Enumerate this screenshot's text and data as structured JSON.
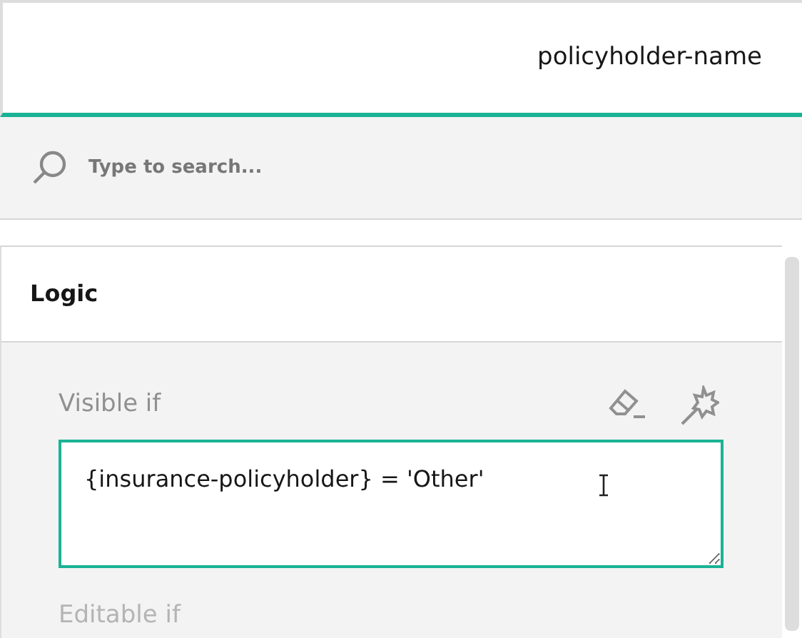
{
  "header": {
    "title": "policyholder-name"
  },
  "search": {
    "placeholder": "Type to search..."
  },
  "section": {
    "title": "Logic",
    "expanded": true
  },
  "properties": [
    {
      "label": "Visible if",
      "value": "{insurance-policyholder} = 'Other'",
      "focused": true,
      "faded": false
    },
    {
      "label": "Editable if",
      "faded": true
    }
  ]
}
